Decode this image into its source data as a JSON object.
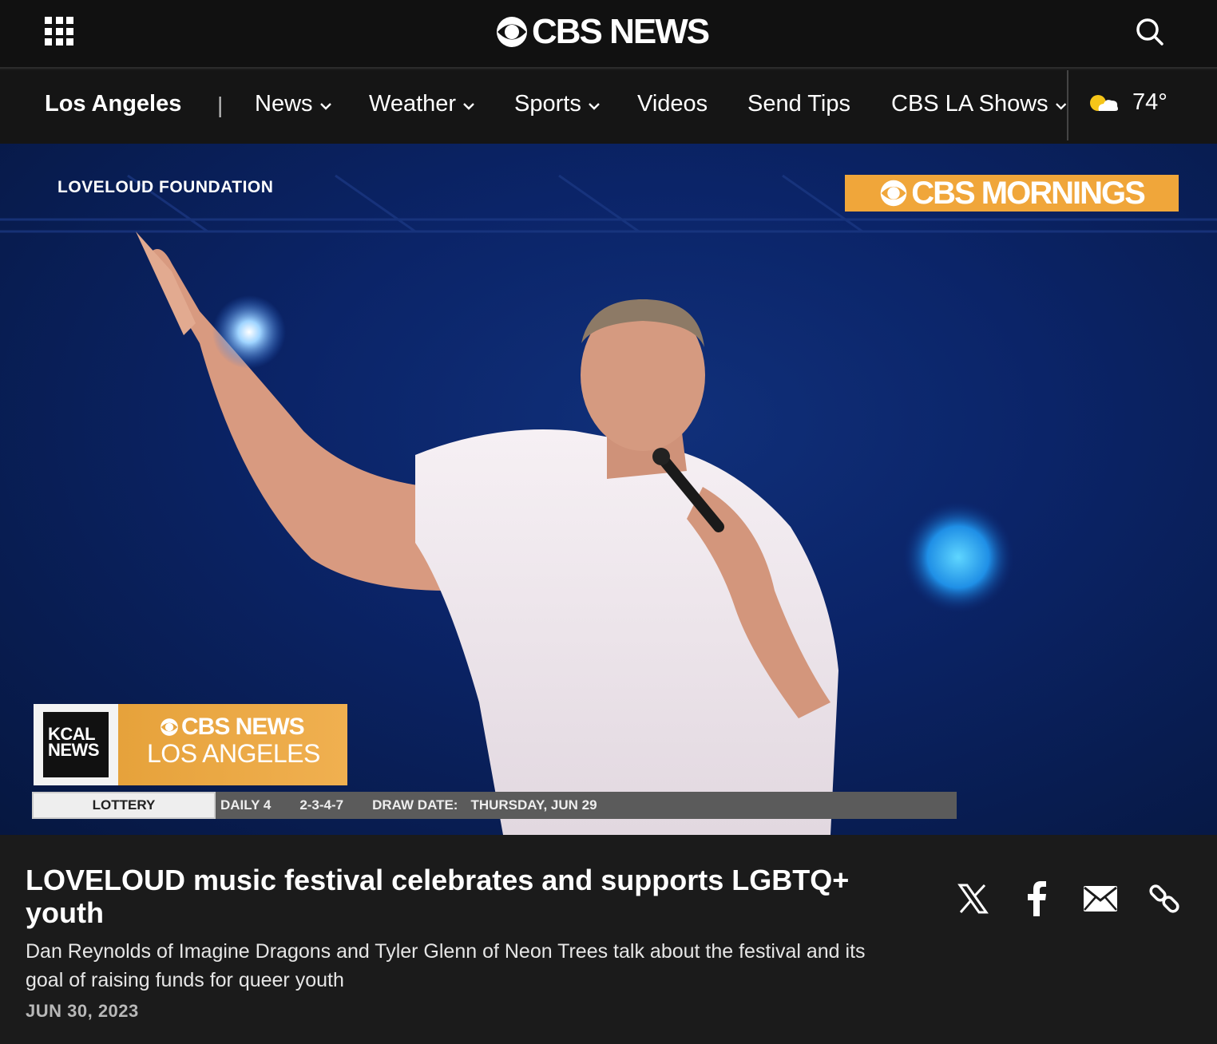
{
  "header": {
    "brand": "CBS NEWS",
    "menu_icon": "grid-menu-icon",
    "search_icon": "search-icon"
  },
  "nav": {
    "city": "Los Angeles",
    "separator": "|",
    "items": [
      {
        "label": "News",
        "has_dropdown": true
      },
      {
        "label": "Weather",
        "has_dropdown": true
      },
      {
        "label": "Sports",
        "has_dropdown": true
      },
      {
        "label": "Videos",
        "has_dropdown": false
      },
      {
        "label": "Send Tips",
        "has_dropdown": false
      },
      {
        "label": "CBS LA Shows",
        "has_dropdown": true
      }
    ],
    "weather": {
      "temp": "74°",
      "icon": "partly-cloudy-icon"
    }
  },
  "video": {
    "caption_left": "LOVELOUD FOUNDATION",
    "show_bug": "CBS MORNINGS",
    "station_bug": {
      "kcal_line1": "KCAL",
      "kcal_line2": "NEWS",
      "network": "CBS NEWS",
      "city": "LOS ANGELES"
    },
    "ticker": {
      "label": "LOTTERY",
      "game": "DAILY 4",
      "numbers": "2-3-4-7",
      "draw_label": "DRAW DATE:",
      "draw_date": "THURSDAY, JUN 29"
    }
  },
  "article": {
    "headline": "LOVELOUD music festival celebrates and supports LGBTQ+ youth",
    "dek": "Dan Reynolds of Imagine Dragons and Tyler Glenn of Neon Trees talk about the festival and its goal of raising funds for queer youth",
    "date": "JUN 30, 2023"
  },
  "share": [
    "x-icon",
    "facebook-icon",
    "email-icon",
    "link-icon"
  ],
  "colors": {
    "background": "#1b1b1b",
    "topbar": "#111111",
    "accent_gold": "#f0a63a",
    "video_blue": "#0b2468"
  }
}
